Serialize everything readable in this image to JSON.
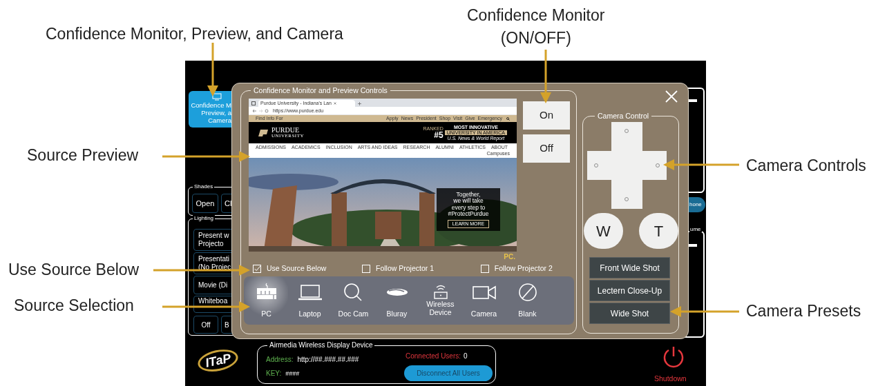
{
  "annotations": [
    {
      "lines": [
        "Confidence Monitor, Preview, and Camera"
      ]
    },
    {
      "lines": [
        "Confidence Monitor",
        "(ON/OFF)"
      ]
    },
    {
      "lines": [
        "Source Preview"
      ]
    },
    {
      "lines": [
        "Use Source Below"
      ]
    },
    {
      "lines": [
        "Source Selection"
      ]
    },
    {
      "lines": [
        "Camera Controls"
      ]
    },
    {
      "lines": [
        "Camera Presets"
      ]
    }
  ],
  "panel": {
    "nav_button": {
      "lines": [
        "Confidence M",
        "Preview, a",
        "Camera"
      ]
    },
    "shades": {
      "title": "Shades",
      "buttons": [
        "Open",
        "Cl"
      ]
    },
    "lighting": {
      "title": "Lighting",
      "buttons": [
        [
          "Present w",
          "Projecto"
        ],
        [
          "Presentati",
          "(No Projec"
        ],
        [
          "Movie (Di"
        ],
        [
          "Whiteboa"
        ]
      ],
      "bottom_buttons": [
        "Off",
        "B"
      ]
    },
    "right_edge": {
      "pill": "hone",
      "volume_label": "ume"
    },
    "logo": "ITaP",
    "airmedia": {
      "title": "Airmedia Wireless Display Device",
      "address_label": "Address:",
      "address": "http://##.###.##.###",
      "key_label": "KEY:",
      "key": "####",
      "users_label": "Connected Users:",
      "users": "0",
      "disconnect": "Disconnect All Users"
    },
    "shutdown": "Shutdown"
  },
  "modal": {
    "preview_section": {
      "title": "Confidence Monitor and Preview Controls",
      "browser": {
        "tab_title": "Purdue University - Indiana's Lan",
        "url": "https://www.purdue.edu",
        "find_info": "Find Info For",
        "top_links": [
          "Apply",
          "News",
          "President",
          "Shop",
          "Visit",
          "Give",
          "Emergency"
        ],
        "logo_word": "PURDUE",
        "logo_sub": "UNIVERSITY",
        "ranked": "RANKED",
        "rank": "#5",
        "ranking_title": "MOST INNOVATIVE",
        "ranking_sub": "UNIVERSITY IN AMERICA",
        "ranking_source": "U.S. News & World Report",
        "nav": [
          "ADMISSIONS",
          "ACADEMICS",
          "INCLUSION",
          "ARTS AND IDEAS",
          "RESEARCH",
          "ALUMNI",
          "ATHLETICS",
          "ABOUT"
        ],
        "campuses": "Campuses",
        "hero_lines": [
          "Together,",
          "we will take",
          "every step to",
          "#ProtectPurdue"
        ],
        "hero_button": "LEARN MORE"
      },
      "monitor_buttons": [
        "On",
        "Off"
      ],
      "source_tag": "PC.",
      "options": [
        {
          "label": "Use Source Below",
          "checked": true
        },
        {
          "label": "Follow Projector 1",
          "checked": false
        },
        {
          "label": "Follow Projector 2",
          "checked": false
        }
      ],
      "sources": [
        {
          "lines": [
            "PC"
          ],
          "selected": true
        },
        {
          "lines": [
            "Laptop"
          ],
          "selected": false
        },
        {
          "lines": [
            "Doc Cam"
          ],
          "selected": false
        },
        {
          "lines": [
            "Bluray"
          ],
          "selected": false
        },
        {
          "lines": [
            "Wireless",
            "Device"
          ],
          "selected": false
        },
        {
          "lines": [
            "Camera"
          ],
          "selected": false
        },
        {
          "lines": [
            "Blank"
          ],
          "selected": false
        }
      ]
    },
    "camera": {
      "title": "Camera Control",
      "zoom_buttons": [
        "W",
        "T"
      ],
      "presets": [
        "Front Wide Shot",
        "Lectern Close-Up",
        "Wide Shot"
      ]
    }
  }
}
